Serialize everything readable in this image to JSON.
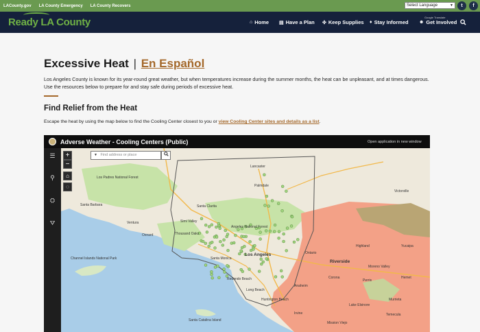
{
  "topbar": {
    "links": [
      "LACounty.gov",
      "LA County Emergency",
      "LA County Recovers"
    ],
    "language_select": "Select Language",
    "social": [
      "twitter-icon",
      "facebook-icon"
    ]
  },
  "nav": {
    "logo": "Ready LA County",
    "items": [
      {
        "label": "Home",
        "icon": "home-icon"
      },
      {
        "label": "Have a Plan",
        "icon": "document-icon"
      },
      {
        "label": "Keep Supplies",
        "icon": "wrench-icon"
      },
      {
        "label": "Stay Informed",
        "icon": "bell-icon"
      },
      {
        "label": "Get Involved",
        "icon": "people-icon"
      }
    ],
    "google_translate": "Google Translate"
  },
  "content": {
    "title": "Excessive Heat",
    "title_sep": "|",
    "title_link": "En Español",
    "intro": "Los Angeles County is known for its year-round great weather, but when temperatures increase during the summer months, the heat can be unpleasant, and at times dangerous. Use the resources below to prepare for and stay safe during periods of excessive heat.",
    "section_title": "Find Relief from the Heat",
    "relief_text": "Escape the heat by using the map below to find the Cooling Center closest to you or ",
    "relief_link": "view Cooling Center sites and details as a list",
    "relief_end": "."
  },
  "map_app": {
    "title": "Adverse Weather - Cooling Centers (Public)",
    "open_link": "Open application in new window",
    "search_placeholder": "Find address or place",
    "zoom_in": "+",
    "zoom_out": "−",
    "sidebar_icons": [
      "list-icon",
      "pin-icon",
      "layers-icon",
      "filter-icon"
    ],
    "places": [
      {
        "name": "Lancaster",
        "size": "small"
      },
      {
        "name": "Palmdale",
        "size": "small"
      },
      {
        "name": "Victorville",
        "size": "small"
      },
      {
        "name": "Santa Clarita",
        "size": "small"
      },
      {
        "name": "Santa Barbara",
        "size": "small"
      },
      {
        "name": "Ventura",
        "size": "small"
      },
      {
        "name": "Oxnard",
        "size": "small"
      },
      {
        "name": "Thousand Oaks",
        "size": "small"
      },
      {
        "name": "Simi Valley",
        "size": "small"
      },
      {
        "name": "Los Padres National Forest",
        "size": "small"
      },
      {
        "name": "Angeles National Forest",
        "size": "small"
      },
      {
        "name": "Santa Monica",
        "size": "small"
      },
      {
        "name": "Los Angeles",
        "size": "big"
      },
      {
        "name": "Long Beach",
        "size": "small"
      },
      {
        "name": "Redondo Beach",
        "size": "small"
      },
      {
        "name": "Huntington Beach",
        "size": "small"
      },
      {
        "name": "Anaheim",
        "size": "small"
      },
      {
        "name": "Irvine",
        "size": "small"
      },
      {
        "name": "Riverside",
        "size": "big"
      },
      {
        "name": "Ontario",
        "size": "small"
      },
      {
        "name": "Moreno Valley",
        "size": "small"
      },
      {
        "name": "Corona",
        "size": "small"
      },
      {
        "name": "Hemet",
        "size": "small"
      },
      {
        "name": "Perris",
        "size": "small"
      },
      {
        "name": "Temecula",
        "size": "small"
      },
      {
        "name": "Highland",
        "size": "small"
      },
      {
        "name": "Mission Viejo",
        "size": "small"
      },
      {
        "name": "Lake Elsinore",
        "size": "small"
      },
      {
        "name": "Murrieta",
        "size": "small"
      },
      {
        "name": "Yucaipa",
        "size": "small"
      },
      {
        "name": "Channel Islands National Park",
        "size": "small"
      },
      {
        "name": "Santa Catalina Island",
        "size": "small"
      }
    ],
    "colors": {
      "ocean": "#a9cde8",
      "land": "#eee9dc",
      "green": "#c7e3a8",
      "heat": "#f3a187",
      "dot": "#9fd37d"
    }
  }
}
